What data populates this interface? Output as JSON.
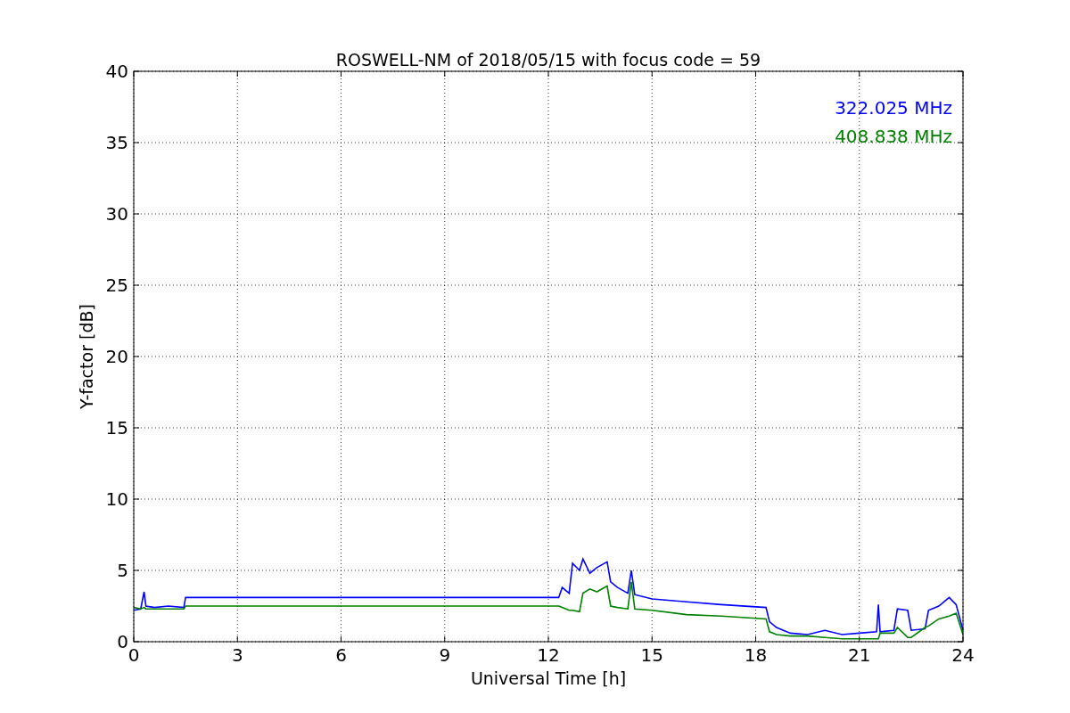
{
  "chart_data": {
    "type": "line",
    "title": "ROSWELL-NM of 2018/05/15 with focus code = 59",
    "xlabel": "Universal Time [h]",
    "ylabel": "Y-factor [dB]",
    "grid": true,
    "xlim": [
      0,
      24
    ],
    "ylim": [
      0,
      40
    ],
    "xticks": [
      0,
      3,
      6,
      9,
      12,
      15,
      18,
      21,
      24
    ],
    "yticks": [
      0,
      5,
      10,
      15,
      20,
      25,
      30,
      35,
      40
    ],
    "x": [
      0,
      0.2,
      0.3,
      0.35,
      0.6,
      1.0,
      1.45,
      1.5,
      12.3,
      12.4,
      12.6,
      12.7,
      12.9,
      13.0,
      13.2,
      13.4,
      13.7,
      13.8,
      14.0,
      14.3,
      14.4,
      14.5,
      15,
      16,
      17,
      18.3,
      18.4,
      18.6,
      19,
      19.5,
      20,
      20.5,
      21,
      21.5,
      21.55,
      21.6,
      22,
      22.1,
      22.4,
      22.5,
      22.9,
      23.0,
      23.3,
      23.6,
      23.8,
      24
    ],
    "series": [
      {
        "name": "322.025 MHz",
        "color": "#0000ff",
        "values": [
          2.2,
          2.3,
          3.5,
          2.5,
          2.4,
          2.5,
          2.4,
          3.1,
          3.1,
          3.8,
          3.4,
          5.5,
          5.0,
          5.8,
          4.8,
          5.2,
          5.6,
          4.2,
          3.8,
          3.4,
          5.0,
          3.3,
          3.0,
          2.8,
          2.6,
          2.4,
          1.4,
          1.0,
          0.6,
          0.5,
          0.8,
          0.5,
          0.6,
          0.7,
          2.6,
          0.7,
          0.8,
          2.3,
          2.2,
          0.8,
          0.9,
          2.2,
          2.5,
          3.1,
          2.6,
          0.8
        ]
      },
      {
        "name": "408.838 MHz",
        "color": "#008000",
        "values": [
          2.4,
          2.3,
          2.4,
          2.3,
          2.3,
          2.3,
          2.3,
          2.5,
          2.5,
          2.4,
          2.2,
          2.2,
          2.1,
          3.4,
          3.7,
          3.5,
          3.9,
          2.5,
          2.4,
          2.3,
          4.2,
          2.3,
          2.2,
          1.9,
          1.8,
          1.6,
          0.7,
          0.5,
          0.4,
          0.4,
          0.3,
          0.2,
          0.2,
          0.2,
          0.2,
          0.6,
          0.6,
          1.0,
          0.3,
          0.3,
          1.0,
          1.1,
          1.6,
          1.8,
          2.0,
          0.5
        ]
      }
    ]
  }
}
